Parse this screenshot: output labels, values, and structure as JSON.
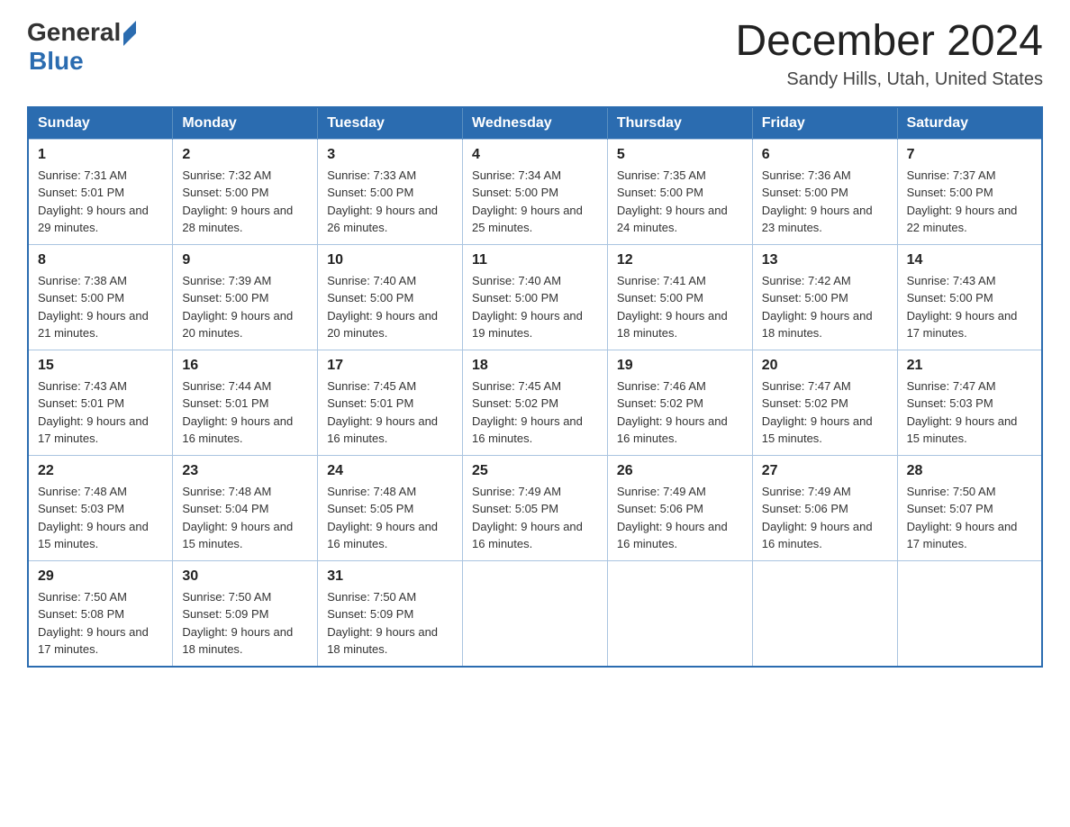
{
  "logo": {
    "general": "General",
    "blue": "Blue"
  },
  "title": {
    "month_year": "December 2024",
    "location": "Sandy Hills, Utah, United States"
  },
  "calendar": {
    "headers": [
      "Sunday",
      "Monday",
      "Tuesday",
      "Wednesday",
      "Thursday",
      "Friday",
      "Saturday"
    ],
    "weeks": [
      [
        {
          "day": "1",
          "sunrise": "7:31 AM",
          "sunset": "5:01 PM",
          "daylight": "9 hours and 29 minutes."
        },
        {
          "day": "2",
          "sunrise": "7:32 AM",
          "sunset": "5:00 PM",
          "daylight": "9 hours and 28 minutes."
        },
        {
          "day": "3",
          "sunrise": "7:33 AM",
          "sunset": "5:00 PM",
          "daylight": "9 hours and 26 minutes."
        },
        {
          "day": "4",
          "sunrise": "7:34 AM",
          "sunset": "5:00 PM",
          "daylight": "9 hours and 25 minutes."
        },
        {
          "day": "5",
          "sunrise": "7:35 AM",
          "sunset": "5:00 PM",
          "daylight": "9 hours and 24 minutes."
        },
        {
          "day": "6",
          "sunrise": "7:36 AM",
          "sunset": "5:00 PM",
          "daylight": "9 hours and 23 minutes."
        },
        {
          "day": "7",
          "sunrise": "7:37 AM",
          "sunset": "5:00 PM",
          "daylight": "9 hours and 22 minutes."
        }
      ],
      [
        {
          "day": "8",
          "sunrise": "7:38 AM",
          "sunset": "5:00 PM",
          "daylight": "9 hours and 21 minutes."
        },
        {
          "day": "9",
          "sunrise": "7:39 AM",
          "sunset": "5:00 PM",
          "daylight": "9 hours and 20 minutes."
        },
        {
          "day": "10",
          "sunrise": "7:40 AM",
          "sunset": "5:00 PM",
          "daylight": "9 hours and 20 minutes."
        },
        {
          "day": "11",
          "sunrise": "7:40 AM",
          "sunset": "5:00 PM",
          "daylight": "9 hours and 19 minutes."
        },
        {
          "day": "12",
          "sunrise": "7:41 AM",
          "sunset": "5:00 PM",
          "daylight": "9 hours and 18 minutes."
        },
        {
          "day": "13",
          "sunrise": "7:42 AM",
          "sunset": "5:00 PM",
          "daylight": "9 hours and 18 minutes."
        },
        {
          "day": "14",
          "sunrise": "7:43 AM",
          "sunset": "5:00 PM",
          "daylight": "9 hours and 17 minutes."
        }
      ],
      [
        {
          "day": "15",
          "sunrise": "7:43 AM",
          "sunset": "5:01 PM",
          "daylight": "9 hours and 17 minutes."
        },
        {
          "day": "16",
          "sunrise": "7:44 AM",
          "sunset": "5:01 PM",
          "daylight": "9 hours and 16 minutes."
        },
        {
          "day": "17",
          "sunrise": "7:45 AM",
          "sunset": "5:01 PM",
          "daylight": "9 hours and 16 minutes."
        },
        {
          "day": "18",
          "sunrise": "7:45 AM",
          "sunset": "5:02 PM",
          "daylight": "9 hours and 16 minutes."
        },
        {
          "day": "19",
          "sunrise": "7:46 AM",
          "sunset": "5:02 PM",
          "daylight": "9 hours and 16 minutes."
        },
        {
          "day": "20",
          "sunrise": "7:47 AM",
          "sunset": "5:02 PM",
          "daylight": "9 hours and 15 minutes."
        },
        {
          "day": "21",
          "sunrise": "7:47 AM",
          "sunset": "5:03 PM",
          "daylight": "9 hours and 15 minutes."
        }
      ],
      [
        {
          "day": "22",
          "sunrise": "7:48 AM",
          "sunset": "5:03 PM",
          "daylight": "9 hours and 15 minutes."
        },
        {
          "day": "23",
          "sunrise": "7:48 AM",
          "sunset": "5:04 PM",
          "daylight": "9 hours and 15 minutes."
        },
        {
          "day": "24",
          "sunrise": "7:48 AM",
          "sunset": "5:05 PM",
          "daylight": "9 hours and 16 minutes."
        },
        {
          "day": "25",
          "sunrise": "7:49 AM",
          "sunset": "5:05 PM",
          "daylight": "9 hours and 16 minutes."
        },
        {
          "day": "26",
          "sunrise": "7:49 AM",
          "sunset": "5:06 PM",
          "daylight": "9 hours and 16 minutes."
        },
        {
          "day": "27",
          "sunrise": "7:49 AM",
          "sunset": "5:06 PM",
          "daylight": "9 hours and 16 minutes."
        },
        {
          "day": "28",
          "sunrise": "7:50 AM",
          "sunset": "5:07 PM",
          "daylight": "9 hours and 17 minutes."
        }
      ],
      [
        {
          "day": "29",
          "sunrise": "7:50 AM",
          "sunset": "5:08 PM",
          "daylight": "9 hours and 17 minutes."
        },
        {
          "day": "30",
          "sunrise": "7:50 AM",
          "sunset": "5:09 PM",
          "daylight": "9 hours and 18 minutes."
        },
        {
          "day": "31",
          "sunrise": "7:50 AM",
          "sunset": "5:09 PM",
          "daylight": "9 hours and 18 minutes."
        },
        null,
        null,
        null,
        null
      ]
    ]
  }
}
